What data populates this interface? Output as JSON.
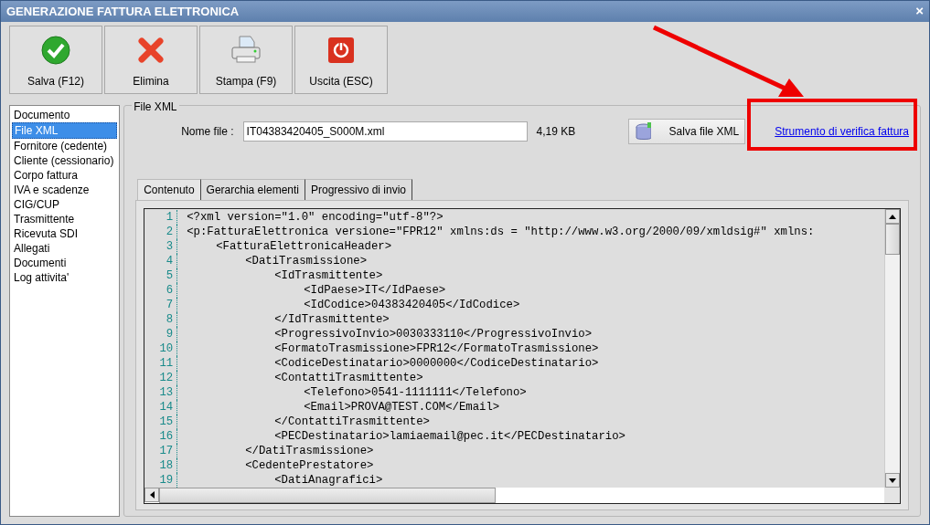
{
  "window": {
    "title": "GENERAZIONE FATTURA ELETTRONICA",
    "close": "×"
  },
  "toolbar": [
    {
      "kind": "check",
      "label": "Salva (F12)"
    },
    {
      "kind": "cross",
      "label": "Elimina"
    },
    {
      "kind": "printer",
      "label": "Stampa (F9)"
    },
    {
      "kind": "power",
      "label": "Uscita (ESC)"
    }
  ],
  "sidebar": {
    "items": [
      {
        "label": "Documento",
        "selected": false
      },
      {
        "label": "File XML",
        "selected": true
      },
      {
        "label": "Fornitore (cedente)",
        "selected": false
      },
      {
        "label": "Cliente (cessionario)",
        "selected": false
      },
      {
        "label": "Corpo fattura",
        "selected": false
      },
      {
        "label": "IVA e scadenze",
        "selected": false
      },
      {
        "label": "CIG/CUP",
        "selected": false
      },
      {
        "label": "Trasmittente",
        "selected": false
      },
      {
        "label": "Ricevuta SDI",
        "selected": false
      },
      {
        "label": "Allegati",
        "selected": false
      },
      {
        "label": "Documenti",
        "selected": false
      },
      {
        "label": "Log attivita'",
        "selected": false
      }
    ]
  },
  "file_panel": {
    "title": "File XML",
    "file_label": "Nome file :",
    "file_name": "IT04383420405_S000M.xml",
    "size": "4,19 KB",
    "save_button": "Salva file XML",
    "verify_link": "Strumento di verifica fattura"
  },
  "tabs": [
    {
      "label": "Contenuto",
      "selected": true
    },
    {
      "label": "Gerarchia elementi",
      "selected": false
    },
    {
      "label": "Progressivo di invio",
      "selected": false
    }
  ],
  "code_lines": [
    {
      "num": "1",
      "text": "<?xml version=\"1.0\" encoding=\"utf-8\"?>"
    },
    {
      "num": "2",
      "text": "<p:FatturaElettronica versione=\"FPR12\" xmlns:ds = \"http://www.w3.org/2000/09/xmldsig#\" xmlns:",
      "children": [
        {
          "num": "3",
          "text": "<FatturaElettronicaHeader>",
          "children": [
            {
              "num": "4",
              "text": "<DatiTrasmissione>",
              "children": [
                {
                  "num": "5",
                  "text": "<IdTrasmittente>",
                  "children": [
                    {
                      "num": "6",
                      "text": "<IdPaese>IT</IdPaese>"
                    },
                    {
                      "num": "7",
                      "text": "<IdCodice>04383420405</IdCodice>"
                    }
                  ]
                },
                {
                  "num": "8",
                  "text": "</IdTrasmittente>"
                },
                {
                  "num": "9",
                  "text": "<ProgressivoInvio>0030333110</ProgressivoInvio>"
                },
                {
                  "num": "10",
                  "text": "<FormatoTrasmissione>FPR12</FormatoTrasmissione>"
                },
                {
                  "num": "11",
                  "text": "<CodiceDestinatario>0000000</CodiceDestinatario>"
                },
                {
                  "num": "12",
                  "text": "<ContattiTrasmittente>",
                  "children": [
                    {
                      "num": "13",
                      "text": "<Telefono>0541-1111111</Telefono>"
                    },
                    {
                      "num": "14",
                      "text": "<Email>PROVA@TEST.COM</Email>"
                    }
                  ]
                },
                {
                  "num": "15",
                  "text": "</ContattiTrasmittente>"
                },
                {
                  "num": "16",
                  "text": "<PECDestinatario>lamiaemail@pec.it</PECDestinatario>"
                }
              ]
            },
            {
              "num": "17",
              "text": "</DatiTrasmissione>"
            },
            {
              "num": "18",
              "text": "<CedentePrestatore>",
              "children": [
                {
                  "num": "19",
                  "text": "<DatiAnagrafici>"
                }
              ]
            }
          ]
        }
      ]
    }
  ]
}
